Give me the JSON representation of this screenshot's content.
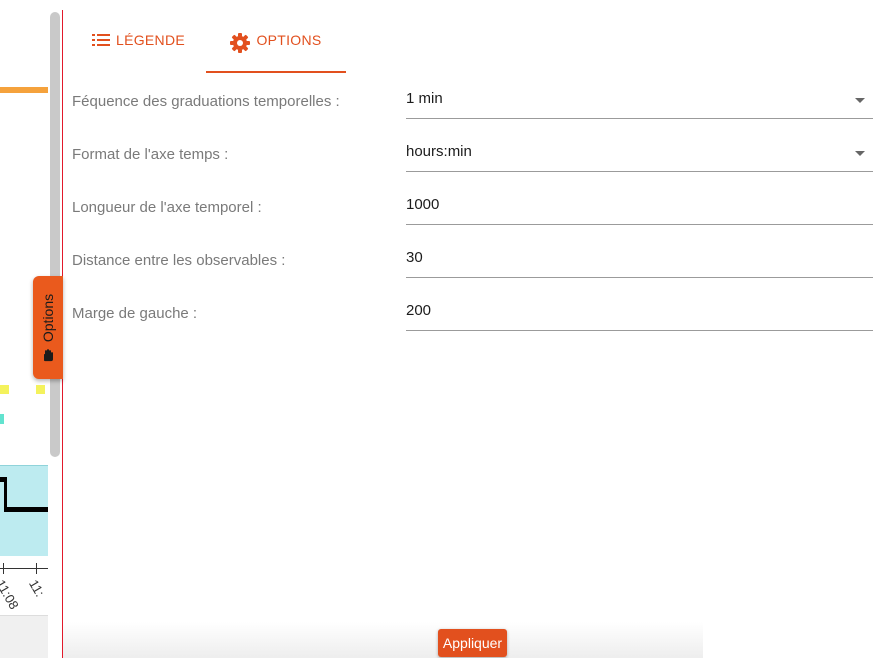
{
  "chart_fragment": {
    "tick_labels": [
      "11:08",
      "11:"
    ]
  },
  "side_tab": {
    "label": "Options",
    "icon": "hand-icon"
  },
  "tabs": [
    {
      "label": "LÉGENDE",
      "icon": "list-icon"
    },
    {
      "label": "OPTIONS",
      "icon": "gear-icon",
      "active": true
    }
  ],
  "form": {
    "tick_frequency": {
      "label": "Féquence des graduations temporelles :",
      "value": "1 min"
    },
    "time_axis_format": {
      "label": "Format de l'axe temps :",
      "value": "hours:min"
    },
    "time_axis_length": {
      "label": "Longueur de l'axe temporel :",
      "value": "1000"
    },
    "observables_distance": {
      "label": "Distance entre les observables :",
      "value": "30"
    },
    "left_margin": {
      "label": "Marge de gauche :",
      "value": "200"
    }
  },
  "apply_label": "Appliquer",
  "colors": {
    "accent": "#e2501e",
    "divider": "#e2192b"
  }
}
